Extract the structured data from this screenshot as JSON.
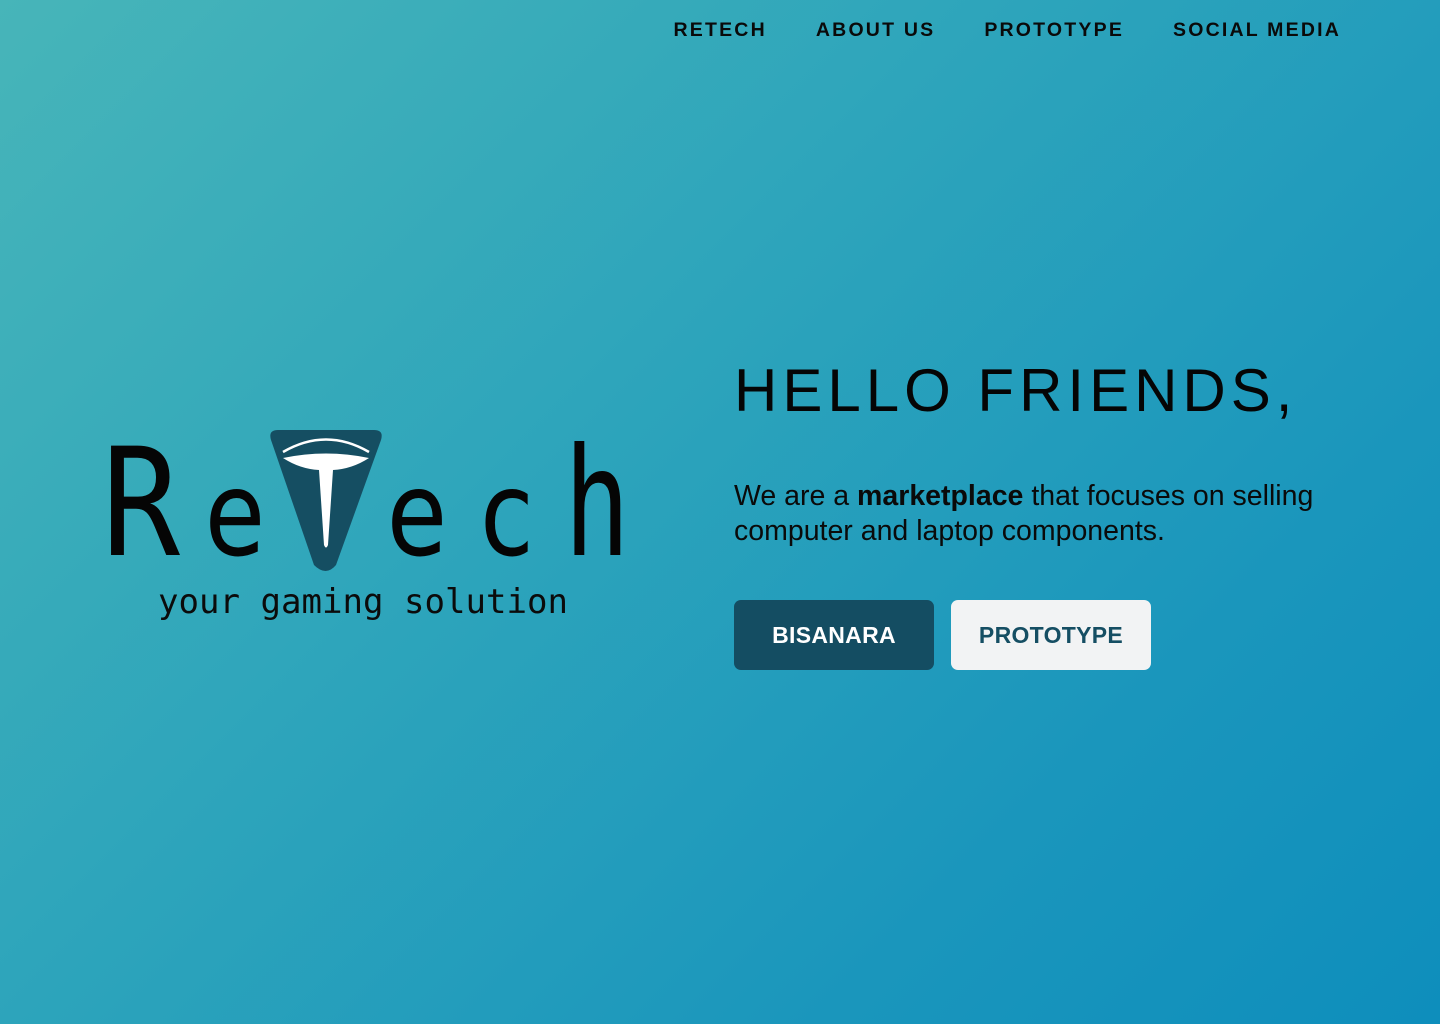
{
  "nav": {
    "items": [
      {
        "label": "RETECH"
      },
      {
        "label": "ABOUT US"
      },
      {
        "label": "PROTOTYPE"
      },
      {
        "label": "SOCIAL MEDIA"
      }
    ]
  },
  "logo": {
    "wordmark": "ReTech",
    "tagline": "your gaming solution",
    "colors": {
      "badge": "#154e62",
      "letters": "#050505",
      "t_mark": "#ffffff"
    }
  },
  "hero": {
    "title": "HELLO FRIENDS,",
    "desc_before": "We are a ",
    "desc_bold": "marketplace",
    "desc_after": " that focuses on selling computer and laptop components.",
    "buttons": {
      "primary": "BISANARA",
      "secondary": "PROTOTYPE"
    }
  },
  "colors": {
    "background_start": "#47b5b9",
    "background_end": "#0e8ebc",
    "primary_button": "#144d62",
    "secondary_button": "#f2f3f4"
  }
}
